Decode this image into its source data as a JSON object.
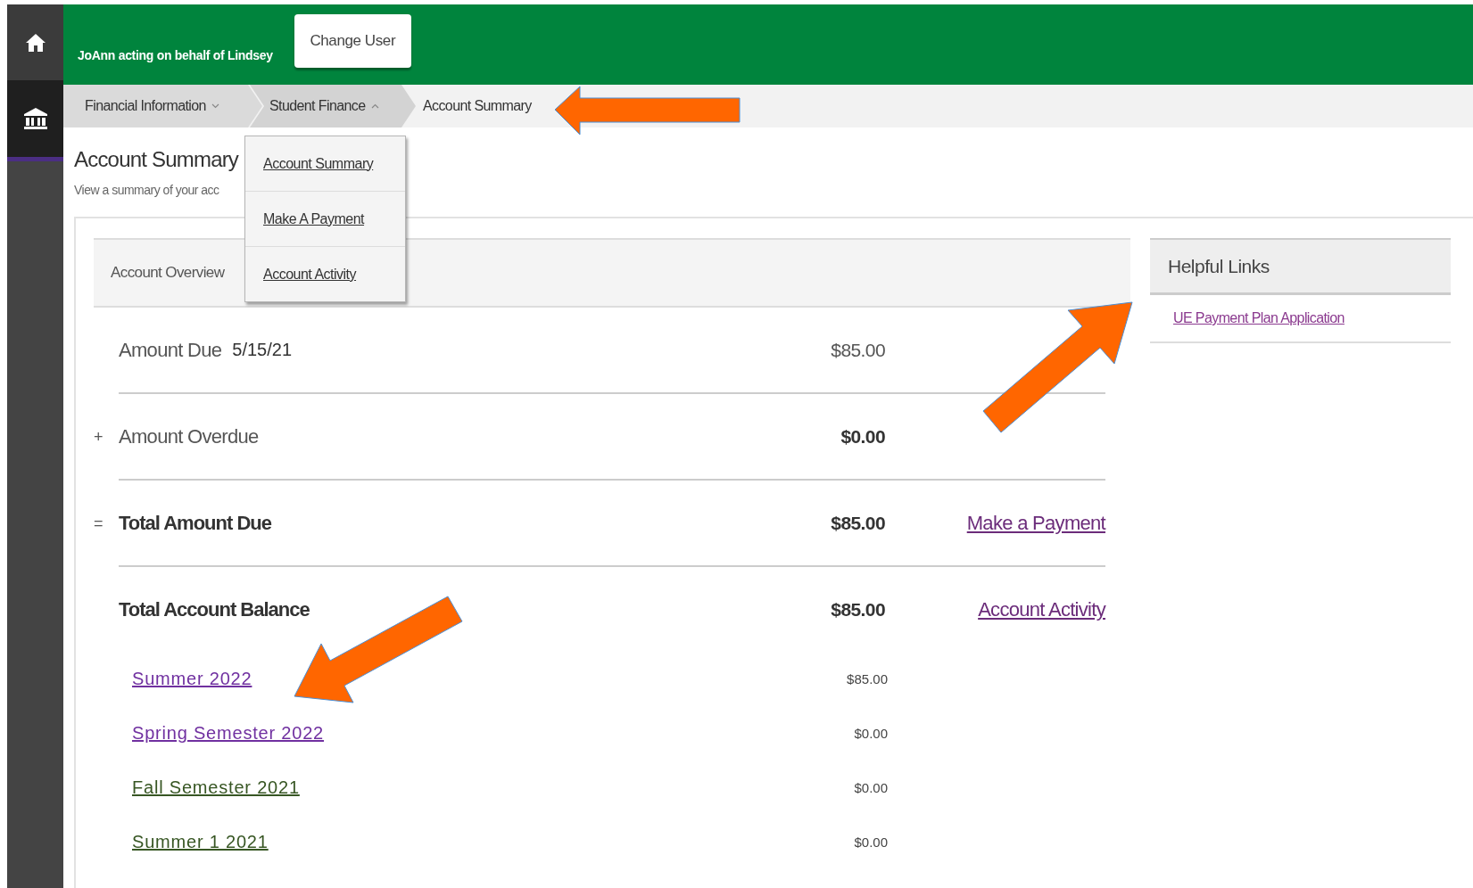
{
  "header": {
    "user_text": "JoAnn acting on behalf of Lindsey",
    "change_user_button": "Change User"
  },
  "breadcrumbs": [
    {
      "label": "Financial Information",
      "kind": "menu",
      "expanded": false,
      "selected": false
    },
    {
      "label": "Student Finance",
      "kind": "menu",
      "expanded": true,
      "selected": false,
      "menu": [
        "Account Summary",
        "Make A Payment",
        "Account Activity"
      ]
    },
    {
      "label": "Account Summary",
      "kind": "current",
      "selected": true
    }
  ],
  "page": {
    "title": "Account Summary",
    "subtitle": "View a summary of your acc"
  },
  "overview": {
    "title": "Account Overview",
    "rows": [
      {
        "label": "Amount Due",
        "date": "5/15/21",
        "amount": "$85.00",
        "label_bold": false,
        "amount_bold": false
      },
      {
        "sign": "+",
        "label": "Amount Overdue",
        "amount": "$0.00",
        "label_bold": false,
        "amount_bold": true
      },
      {
        "sign": "=",
        "label": "Total Amount Due",
        "amount": "$85.00",
        "label_bold": true,
        "amount_bold": true,
        "link": "Make a Payment"
      },
      {
        "label": "Total Account Balance",
        "amount": "$85.00",
        "label_bold": true,
        "amount_bold": true,
        "link": "Account Activity"
      }
    ],
    "terms": [
      {
        "label": "Summer 2022",
        "amount": "$85.00",
        "color": "#7030a0"
      },
      {
        "label": "Spring Semester 2022",
        "amount": "$0.00",
        "color": "#7030a0"
      },
      {
        "label": "Fall Semester 2021",
        "amount": "$0.00",
        "color": "#375623"
      },
      {
        "label": "Summer 1 2021",
        "amount": "$0.00",
        "color": "#375623"
      }
    ]
  },
  "helpful_links": {
    "title": "Helpful Links",
    "links": [
      "UE Payment Plan Application"
    ]
  }
}
